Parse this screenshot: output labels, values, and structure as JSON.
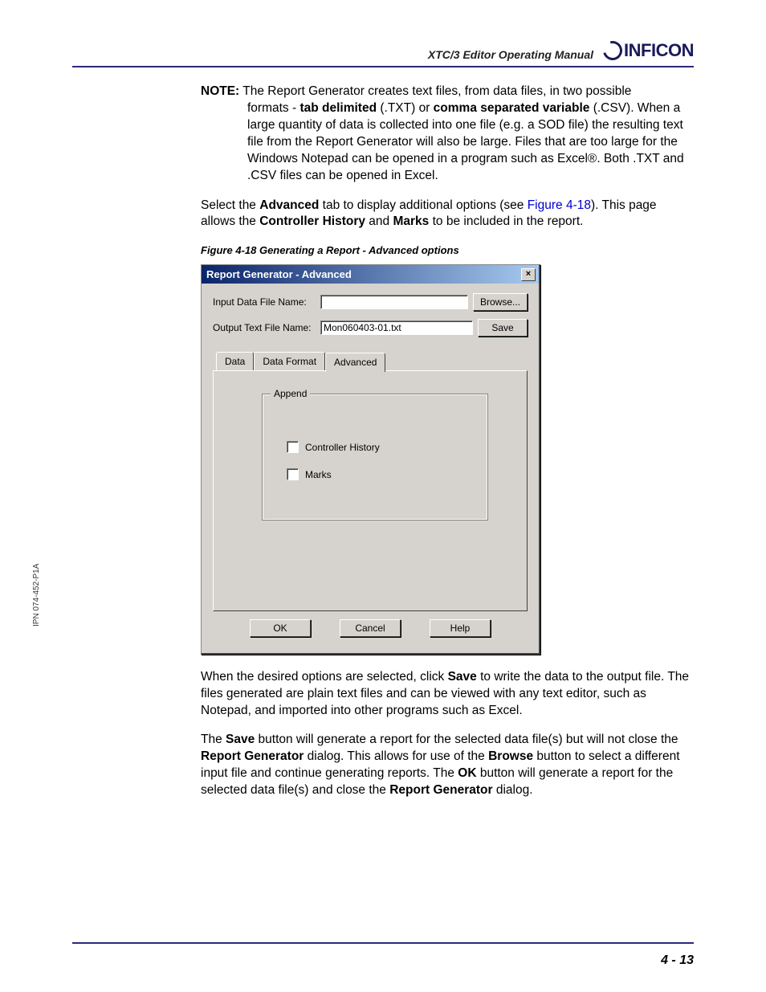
{
  "header": {
    "manual_title": "XTC/3 Editor Operating Manual",
    "brand": "INFICON"
  },
  "note": {
    "label": "NOTE:",
    "line1": "The Report Generator creates text files, from data files, in two possible",
    "line2_pre": "formats - ",
    "bold_tab": "tab delimited",
    "line2_mid": " (.TXT) or ",
    "bold_csv": "comma separated variable",
    "line2_post": " (.CSV). When a large quantity of data is collected into one file (e.g. a SOD file) the resulting text file from the Report Generator will also be large. Files that are too large for the Windows Notepad can be opened in a program such as Excel®. Both .TXT and .CSV files can be opened in Excel."
  },
  "para1": {
    "pre": "Select the ",
    "b1": "Advanced",
    "mid1": " tab to display additional options (see ",
    "link": "Figure 4-18",
    "mid2": "). This page allows the ",
    "b2": "Controller History",
    "mid3": " and ",
    "b3": "Marks",
    "post": " to be included in the report."
  },
  "figure_caption": "Figure 4-18  Generating a Report - Advanced options",
  "dialog": {
    "title": "Report Generator - Advanced",
    "close_glyph": "×",
    "input_label": "Input Data File Name:",
    "input_value": "",
    "output_label": "Output Text File Name:",
    "output_value": "Mon060403-01.txt",
    "browse_btn": "Browse...",
    "save_btn": "Save",
    "tabs": {
      "data": "Data",
      "data_format": "Data Format",
      "advanced": "Advanced"
    },
    "group": {
      "title": "Append",
      "opt1": "Controller History",
      "opt1_checked": false,
      "opt2": "Marks",
      "opt2_checked": false
    },
    "buttons": {
      "ok": "OK",
      "cancel": "Cancel",
      "help": "Help"
    }
  },
  "para2": {
    "pre": "When the desired options are selected, click ",
    "b1": "Save",
    "post": " to write the data to the output file. The files generated are plain text files and can be viewed with any text editor, such as Notepad, and imported into other programs such as Excel."
  },
  "para3": {
    "p1": "The ",
    "b1": "Save",
    "p2": " button will generate a report for the selected data file(s) but will not close the ",
    "b2": "Report Generator",
    "p3": " dialog. This allows for use of the ",
    "b3": "Browse",
    "p4": " button to select a different input file and continue generating reports. The ",
    "b4": "OK",
    "p5": " button will generate a report for the selected data file(s) and close the ",
    "b5": "Report Generator",
    "p6": " dialog."
  },
  "side_text": "IPN 074-452-P1A",
  "page_number": "4 - 13"
}
